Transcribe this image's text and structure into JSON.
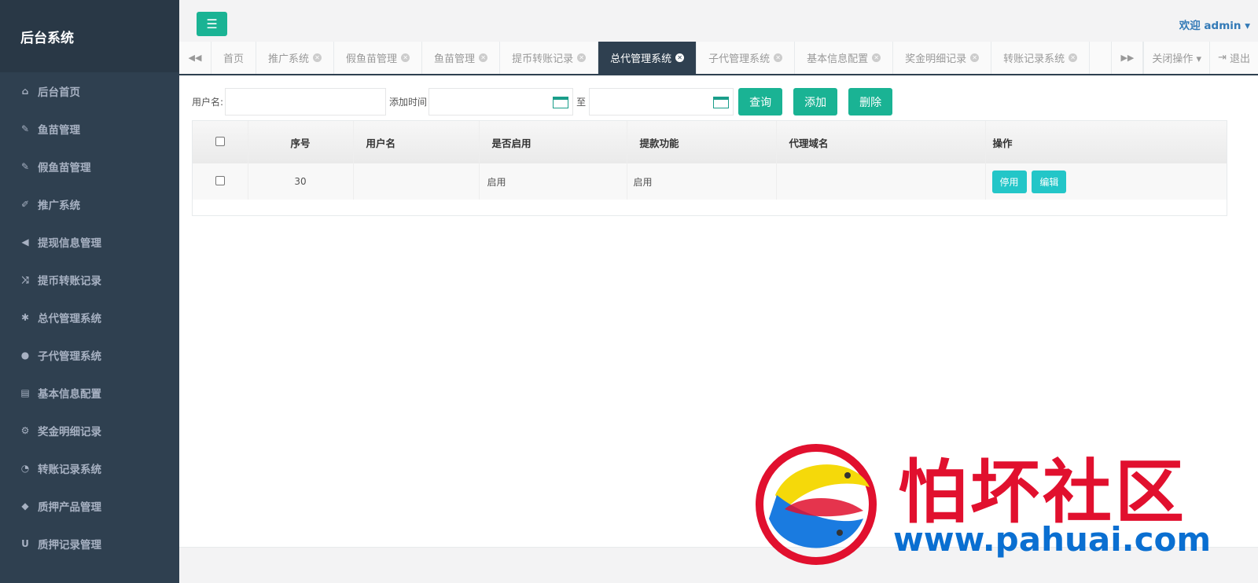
{
  "sidebar": {
    "brand": "后台系统",
    "items": [
      {
        "label": "后台首页",
        "icon": "home-icon",
        "glyph": "⌂"
      },
      {
        "label": "鱼苗管理",
        "icon": "wrench-icon",
        "glyph": "✎"
      },
      {
        "label": "假鱼苗管理",
        "icon": "wrench-icon",
        "glyph": "✎"
      },
      {
        "label": "推广系统",
        "icon": "edit-icon",
        "glyph": "✐"
      },
      {
        "label": "提现信息管理",
        "icon": "bullhorn-icon",
        "glyph": "◀"
      },
      {
        "label": "提币转账记录",
        "icon": "shuffle-icon",
        "glyph": "⤨"
      },
      {
        "label": "总代管理系统",
        "icon": "asterisk-icon",
        "glyph": "✱"
      },
      {
        "label": "子代管理系统",
        "icon": "users-icon",
        "glyph": "●"
      },
      {
        "label": "基本信息配置",
        "icon": "file-icon",
        "glyph": "▤"
      },
      {
        "label": "奖金明细记录",
        "icon": "cogs-icon",
        "glyph": "⚙"
      },
      {
        "label": "转账记录系统",
        "icon": "dashboard-icon",
        "glyph": "◔"
      },
      {
        "label": "质押产品管理",
        "icon": "comment-icon",
        "glyph": "◆"
      },
      {
        "label": "质押记录管理",
        "icon": "magnet-icon",
        "glyph": "U"
      }
    ]
  },
  "topbar": {
    "welcome": "欢迎 admin ▾"
  },
  "tabs": {
    "items": [
      {
        "label": "首页",
        "closable": false
      },
      {
        "label": "推广系统",
        "closable": true
      },
      {
        "label": "假鱼苗管理",
        "closable": true
      },
      {
        "label": "鱼苗管理",
        "closable": true
      },
      {
        "label": "提币转账记录",
        "closable": true
      },
      {
        "label": "总代管理系统",
        "closable": true,
        "active": true
      },
      {
        "label": "子代管理系统",
        "closable": true
      },
      {
        "label": "基本信息配置",
        "closable": true
      },
      {
        "label": "奖金明细记录",
        "closable": true
      },
      {
        "label": "转账记录系统",
        "closable": true
      }
    ],
    "close_ops": "关闭操作 ▾",
    "logout": "退出"
  },
  "filter": {
    "username_label": "用户名:",
    "addtime_label": "添加时间",
    "to_label": "至",
    "query_btn": "查询",
    "add_btn": "添加",
    "delete_btn": "删除"
  },
  "table": {
    "headers": [
      "序号",
      "用户名",
      "是否启用",
      "提款功能",
      "代理域名",
      "操作"
    ],
    "rows": [
      {
        "id": "30",
        "username": "",
        "enabled": "启用",
        "withdraw": "启用",
        "domain": "",
        "btn_disable": "停用",
        "btn_edit": "编辑"
      }
    ]
  },
  "watermark": {
    "text": "怕坏社区",
    "url": "www.pahuai.com"
  }
}
